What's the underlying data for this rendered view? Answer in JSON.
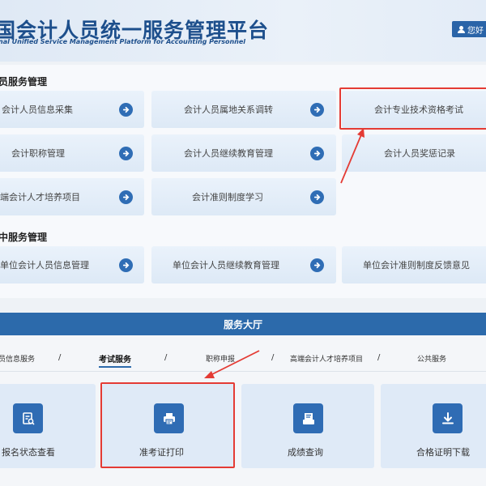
{
  "header": {
    "title": "国会计人员统一服务管理平台",
    "subtitle": "nal Unified Service Management Platform for Accounting Personnel",
    "user_label": "您好"
  },
  "sections": [
    {
      "title": "员服务管理",
      "tiles": [
        {
          "label": "会计人员信息采集",
          "arrow": true
        },
        {
          "label": "会计人员属地关系调转",
          "arrow": true
        },
        {
          "label": "会计专业技术资格考试",
          "arrow": false
        },
        {
          "label": "会计职称管理",
          "arrow": true
        },
        {
          "label": "会计人员继续教育管理",
          "arrow": true
        },
        {
          "label": "会计人员奖惩记录",
          "arrow": false
        },
        {
          "label": "端会计人才培养项目",
          "arrow": true
        },
        {
          "label": "会计准则制度学习",
          "arrow": true
        }
      ]
    },
    {
      "title": "中服务管理",
      "tiles": [
        {
          "label": "单位会计人员信息管理",
          "arrow": true
        },
        {
          "label": "单位会计人员继续教育管理",
          "arrow": true
        },
        {
          "label": "单位会计准则制度反馈意见",
          "arrow": false
        }
      ]
    }
  ],
  "hall": {
    "title": "服务大厅",
    "tabs": [
      {
        "label": "员信息服务",
        "active": false
      },
      {
        "label": "考试服务",
        "active": true
      },
      {
        "label": "职称申报",
        "active": false
      },
      {
        "label": "高端会计人才培养项目",
        "active": false
      },
      {
        "label": "公共服务",
        "active": false
      }
    ],
    "separator": "/",
    "cards": [
      {
        "label": "报名状态查看",
        "icon": "document-search-icon"
      },
      {
        "label": "准考证打印",
        "icon": "printer-icon"
      },
      {
        "label": "成绩查询",
        "icon": "scores-icon"
      },
      {
        "label": "合格证明下载",
        "icon": "download-icon"
      }
    ]
  },
  "colors": {
    "brand_blue": "#2c6aab",
    "annotation_red": "#e43b34",
    "tile_bg": "#e3edf8"
  }
}
